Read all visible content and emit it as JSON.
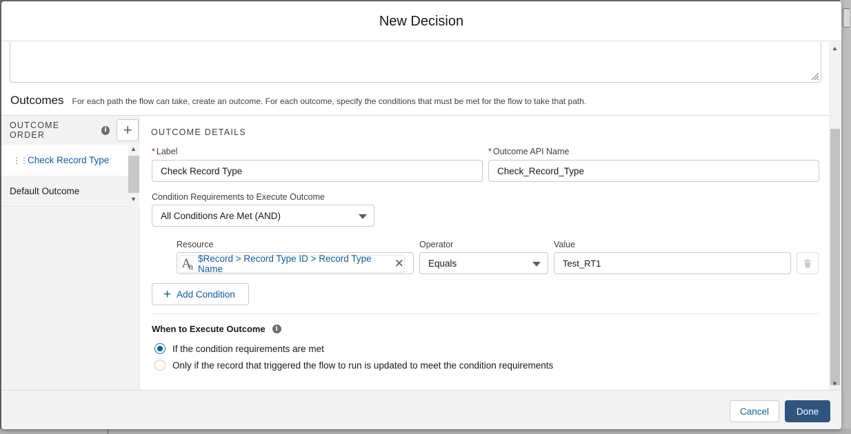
{
  "modal": {
    "title": "New Decision"
  },
  "outcomes": {
    "title": "Outcomes",
    "description": "For each path the flow can take, create an outcome. For each outcome, specify the conditions that must be met for the flow to take that path.",
    "order_label": "OUTCOME ORDER",
    "items": [
      {
        "label": "Check Record Type"
      },
      {
        "label": "Default Outcome"
      }
    ]
  },
  "details": {
    "section_title": "OUTCOME DETAILS",
    "label_field": {
      "label": "Label",
      "value": "Check Record Type"
    },
    "api_field": {
      "label": "Outcome API Name",
      "value": "Check_Record_Type"
    },
    "requirements": {
      "label": "Condition Requirements to Execute Outcome",
      "value": "All Conditions Are Met (AND)"
    },
    "condition": {
      "resource_label": "Resource",
      "resource_value": "$Record > Record Type ID > Record Type Name",
      "operator_label": "Operator",
      "operator_value": "Equals",
      "value_label": "Value",
      "value_value": "Test_RT1"
    },
    "add_condition_label": "Add Condition",
    "when_label": "When to Execute Outcome",
    "options": [
      {
        "label": "If the condition requirements are met",
        "checked": true
      },
      {
        "label": "Only if the record that triggered the flow to run is updated to meet the condition requirements",
        "checked": false
      }
    ]
  },
  "footer": {
    "cancel_label": "Cancel",
    "done_label": "Done"
  },
  "colors": {
    "link": "#0b5cab",
    "brand_button": "#2e5580",
    "required": "#ba0517"
  },
  "icons": [
    "info-icon",
    "plus-icon",
    "drag-handle-icon",
    "text-resource-icon",
    "close-icon",
    "trash-icon",
    "chevron-up-icon",
    "chevron-down-icon"
  ]
}
